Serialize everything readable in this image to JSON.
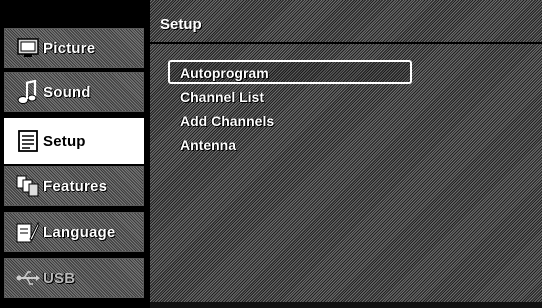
{
  "sidebar": {
    "items": [
      {
        "label": "Picture",
        "icon": "picture-icon",
        "active": false
      },
      {
        "label": "Sound",
        "icon": "sound-icon",
        "active": false
      },
      {
        "label": "Setup",
        "icon": "setup-icon",
        "active": true
      },
      {
        "label": "Features",
        "icon": "features-icon",
        "active": false
      },
      {
        "label": "Language",
        "icon": "language-icon",
        "active": false
      },
      {
        "label": "USB",
        "icon": "usb-icon",
        "active": false
      }
    ]
  },
  "main": {
    "title": "Setup",
    "menu": [
      {
        "label": "Autoprogram",
        "selected": true
      },
      {
        "label": "Channel List",
        "selected": false
      },
      {
        "label": "Add Channels",
        "selected": false
      },
      {
        "label": "Antenna",
        "selected": false
      }
    ]
  },
  "colors": {
    "active_bg": "#ffffff",
    "text": "#ffffff",
    "background": "#000000"
  }
}
